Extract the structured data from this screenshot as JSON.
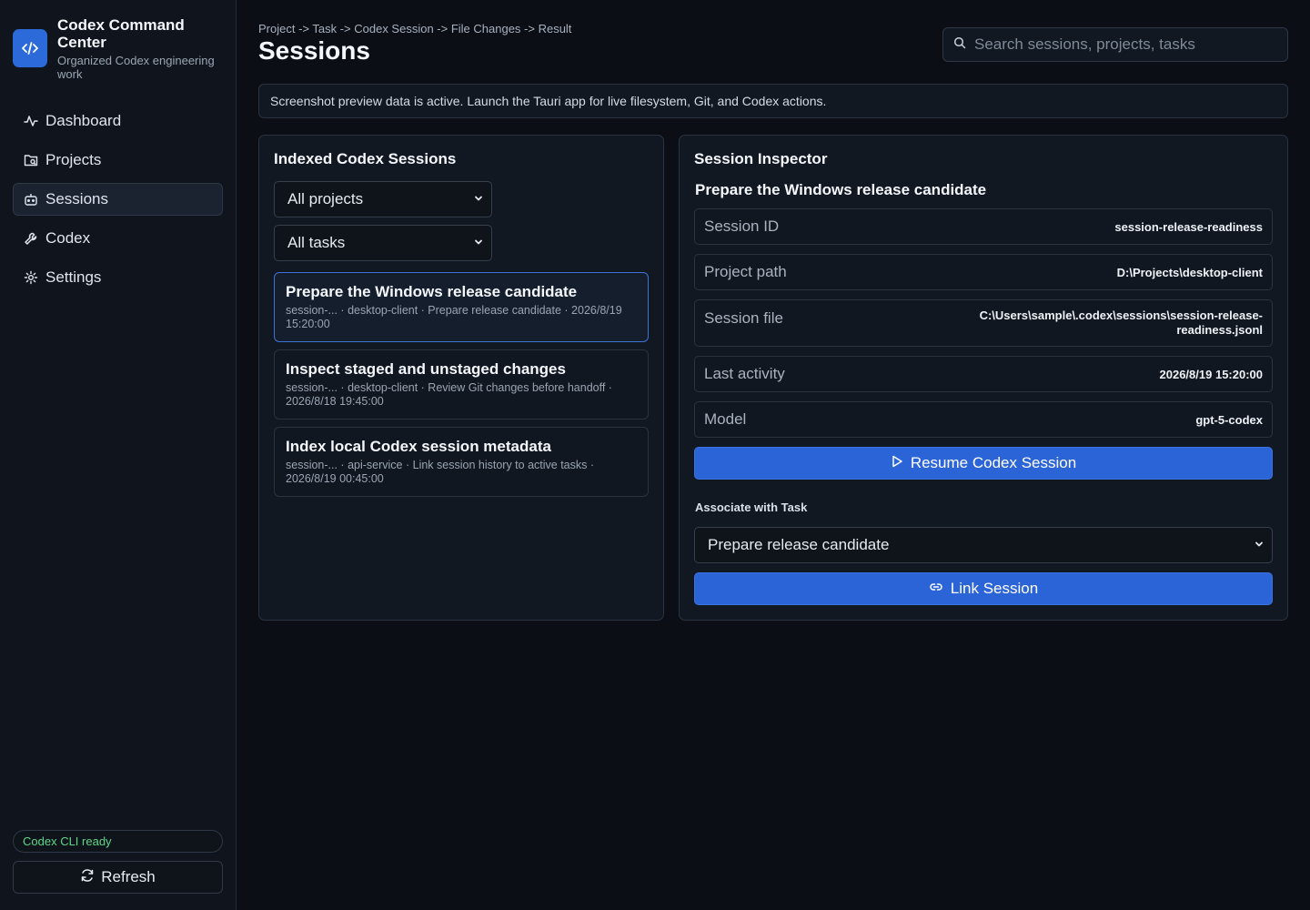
{
  "brand": {
    "title": "Codex Command Center",
    "subtitle": "Organized Codex engineering work"
  },
  "nav": {
    "items": [
      {
        "label": "Dashboard",
        "icon": "activity-icon"
      },
      {
        "label": "Projects",
        "icon": "folder-icon"
      },
      {
        "label": "Sessions",
        "icon": "bot-icon",
        "active": true
      },
      {
        "label": "Codex",
        "icon": "wrench-icon"
      },
      {
        "label": "Settings",
        "icon": "gear-icon"
      }
    ]
  },
  "sidebar_footer": {
    "status": "Codex CLI ready",
    "refresh_label": "Refresh"
  },
  "header": {
    "breadcrumb": "Project -> Task -> Codex Session -> File Changes -> Result",
    "title": "Sessions",
    "search_placeholder": "Search sessions, projects, tasks"
  },
  "notice": "Screenshot preview data is active. Launch the Tauri app for live filesystem, Git, and Codex actions.",
  "sessions_panel": {
    "title": "Indexed Codex Sessions",
    "project_filter": "All projects",
    "task_filter": "All tasks",
    "sessions": [
      {
        "title": "Prepare the Windows release candidate",
        "meta_line1": "session-... · desktop-client · Prepare release candidate · 2026/8/19",
        "meta_line2": "15:20:00",
        "active": true
      },
      {
        "title": "Inspect staged and unstaged changes",
        "meta_line1": "session-... · desktop-client · Review Git changes before handoff ·",
        "meta_line2": "2026/8/18 19:45:00",
        "active": false
      },
      {
        "title": "Index local Codex session metadata",
        "meta_line1": "session-... · api-service · Link session history to active tasks ·",
        "meta_line2": "2026/8/19 00:45:00",
        "active": false
      }
    ]
  },
  "inspector": {
    "title": "Session Inspector",
    "session_title": "Prepare the Windows release candidate",
    "fields": [
      {
        "label": "Session ID",
        "value": "session-release-readiness"
      },
      {
        "label": "Project path",
        "value": "D:\\Projects\\desktop-client"
      },
      {
        "label": "Session file",
        "value_line1": "C:\\Users\\sample\\.codex\\sessions\\session-release-",
        "value_line2": "readiness.jsonl"
      },
      {
        "label": "Last activity",
        "value": "2026/8/19 15:20:00"
      },
      {
        "label": "Model",
        "value": "gpt-5-codex"
      }
    ],
    "resume_label": "Resume Codex Session",
    "associate_label": "Associate with Task",
    "task_select": "Prepare release candidate",
    "link_label": "Link Session"
  },
  "colors": {
    "accent": "#2b64d6",
    "status_ok": "#5ed68a",
    "background": "#0b0f15"
  }
}
